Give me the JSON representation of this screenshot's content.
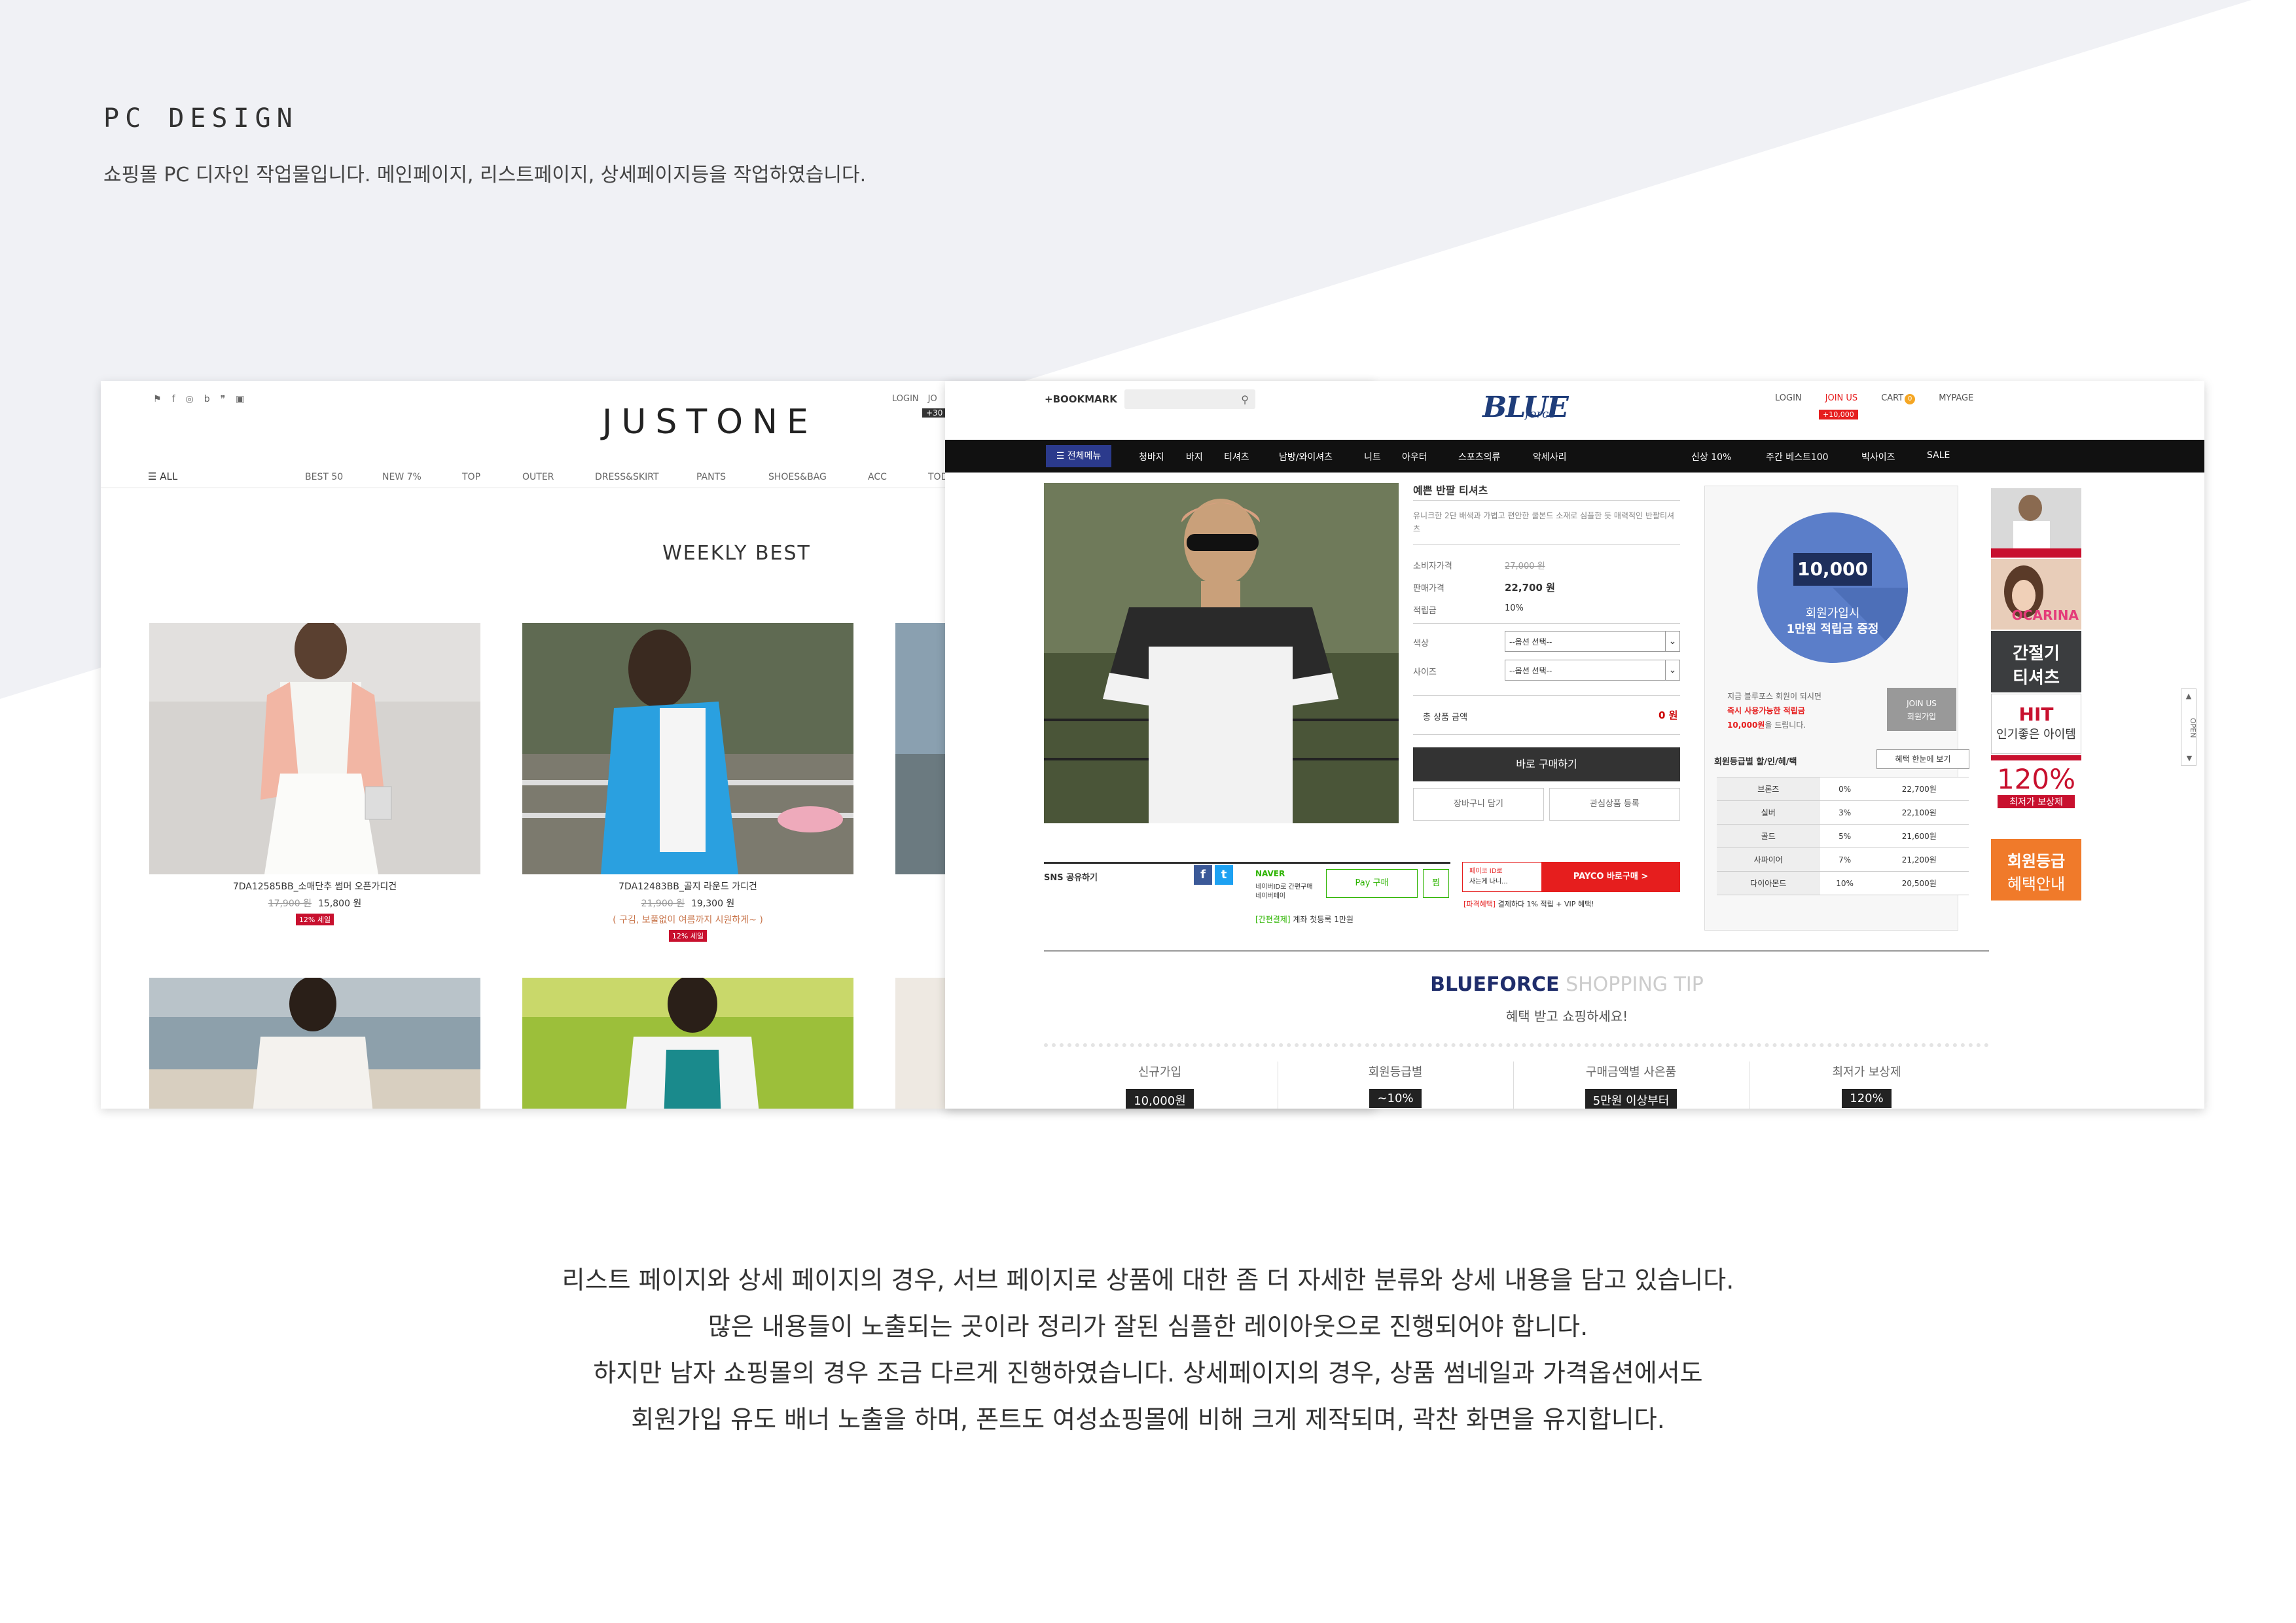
{
  "page": {
    "title": "PC DESIGN",
    "subtitle": "쇼핑몰 PC 디자인 작업물입니다. 메인페이지, 리스트페이지, 상세페이지등을 작업하였습니다."
  },
  "colors": {
    "bg_shape": "#f0f1f5",
    "justone_sale": "#c8102e",
    "blue_primary": "#2b3a8c",
    "blue_circle": "#5b7ec9",
    "payco_red": "#e61e1e",
    "naver_green": "#2db400",
    "ad_red": "#c8102e",
    "ad_orange": "#f07a2a"
  },
  "justone": {
    "sns_icons": [
      "bookmark-icon",
      "facebook-icon",
      "instagram-icon",
      "blog-icon",
      "kakao-icon",
      "app-icon"
    ],
    "sns_glyphs": [
      "⚑",
      "f",
      "◎",
      "b",
      "❞",
      "▣"
    ],
    "logo": "JUSTONE",
    "util_links": [
      "LOGIN",
      "JO"
    ],
    "util_badge": "+30",
    "nav_all": "☰ ALL",
    "nav_items": [
      "BEST 50",
      "NEW 7%",
      "TOP",
      "OUTER",
      "DRESS&SKIRT",
      "PANTS",
      "SHOES&BAG",
      "ACC",
      "TOD"
    ],
    "section_title": "WEEKLY BEST",
    "products": [
      {
        "name": "7DA12585BB_소매단추 썸머 오픈가디건",
        "orig": "17,900 원",
        "price": "15,800 원",
        "note": "",
        "tag": "12% 세일"
      },
      {
        "name": "7DA12483BB_골지 라운드 가디건",
        "orig": "21,900 원",
        "price": "19,300 원",
        "note": "( 구김, 보풀없이 여름까지 시원하게~ )",
        "tag": "12% 세일"
      }
    ]
  },
  "blueforce": {
    "bookmark": "+BOOKMARK",
    "logo": "BLUE",
    "logo_sub": "force",
    "util": {
      "login": "LOGIN",
      "join": "JOIN US",
      "cart": "CART",
      "cart_count": "0",
      "mypage": "MYPAGE",
      "join_badge": "+10,000"
    },
    "nav": {
      "all": "☰ 전체메뉴",
      "items": [
        "청바지",
        "바지",
        "티셔츠",
        "남방/와이셔츠",
        "니트",
        "아우터",
        "스포츠의류",
        "악세사리"
      ],
      "right": [
        "신상 10%",
        "주간 베스트100",
        "빅사이즈",
        "SALE"
      ]
    },
    "product": {
      "name": "예쁜 반팔 티셔츠",
      "desc": "유니크한 2단 배색과 가볍고 편안한 쿨본드 소재로 심플한 듯 매력적인 반팔티셔츠",
      "rows": [
        {
          "label": "소비자가격",
          "value": "27,000 원"
        },
        {
          "label": "판매가격",
          "value": "22,700 원"
        },
        {
          "label": "적립금",
          "value": "10%"
        }
      ],
      "color_label": "색상",
      "size_label": "사이즈",
      "option_placeholder": "--옵션 선택--",
      "total_label": "총 상품 금액",
      "total_value": "0 원",
      "buy": "바로 구매하기",
      "cart": "장바구니 담기",
      "wish": "관심상품 등록"
    },
    "sns_share": "SNS 공유하기",
    "naver": {
      "brand": "NAVER",
      "text1": "네이버ID로 간편구매",
      "text2": "네이버페이",
      "pay": "Pay 구매",
      "wish": "찜",
      "notice_tag": "[간편결제]",
      "notice": "계좌 첫등록 1만원"
    },
    "payco": {
      "left1": "페이코 ID로",
      "left2": "사는게 나니...",
      "btn": "PAYCO 바로구매 >",
      "notice_tag": "[파격혜택]",
      "notice": "결제하다 1% 적립 + VIP 혜택!"
    },
    "side": {
      "amount": "10,000",
      "circle1": "회원가입시",
      "circle2": "1만원 적립금 증정",
      "txt1": "지금 블루포스 회원이 되시면",
      "txt2": "즉시 사용가능한 적립금",
      "txt3": "10,000원",
      "txt3b": "을 드립니다.",
      "join": "JOIN US",
      "join2": "회원가입",
      "grade_title": "회원등급별 할/인/혜/택",
      "grade_btn": "혜택 한눈에 보기",
      "grades": [
        [
          "브론즈",
          "0%",
          "22,700원"
        ],
        [
          "실버",
          "3%",
          "22,100원"
        ],
        [
          "골드",
          "5%",
          "21,600원"
        ],
        [
          "사파이어",
          "7%",
          "21,200원"
        ],
        [
          "다이아몬드",
          "10%",
          "20,500원"
        ]
      ]
    },
    "ads": [
      {
        "label": "",
        "sub": ""
      },
      {
        "label": "OCARINA",
        "sub": ""
      },
      {
        "label": "간절기",
        "sub": "티셔츠"
      },
      {
        "label": "HIT",
        "sub": "인기좋은 아이템"
      },
      {
        "label": "120%",
        "sub": "최저가 보상제"
      },
      {
        "label": "회원등급",
        "sub": "혜택안내"
      }
    ],
    "open_label": "OPEN",
    "tip": {
      "title_a": "BLUEFORCE",
      "title_b": " SHOPPING TIP",
      "sub": "혜택 받고 쇼핑하세요!",
      "cols": [
        {
          "label": "신규가입",
          "value": "10,000원"
        },
        {
          "label": "회원등급별",
          "value": "~10%"
        },
        {
          "label": "구매금액별 사은품",
          "value": "5만원 이상부터"
        },
        {
          "label": "최저가 보상제",
          "value": "120%"
        }
      ]
    }
  },
  "footer": [
    "리스트 페이지와 상세 페이지의 경우, 서브 페이지로 상품에 대한 좀 더 자세한 분류와 상세 내용을 담고 있습니다.",
    "많은 내용들이 노출되는 곳이라 정리가 잘된 심플한 레이아웃으로 진행되어야 합니다.",
    "하지만 남자 쇼핑몰의 경우 조금 다르게 진행하였습니다.  상세페이지의 경우, 상품 썸네일과 가격옵션에서도",
    "회원가입 유도 배너 노출을 하며, 폰트도 여성쇼핑몰에 비해 크게 제작되며, 곽찬 화면을 유지합니다."
  ]
}
